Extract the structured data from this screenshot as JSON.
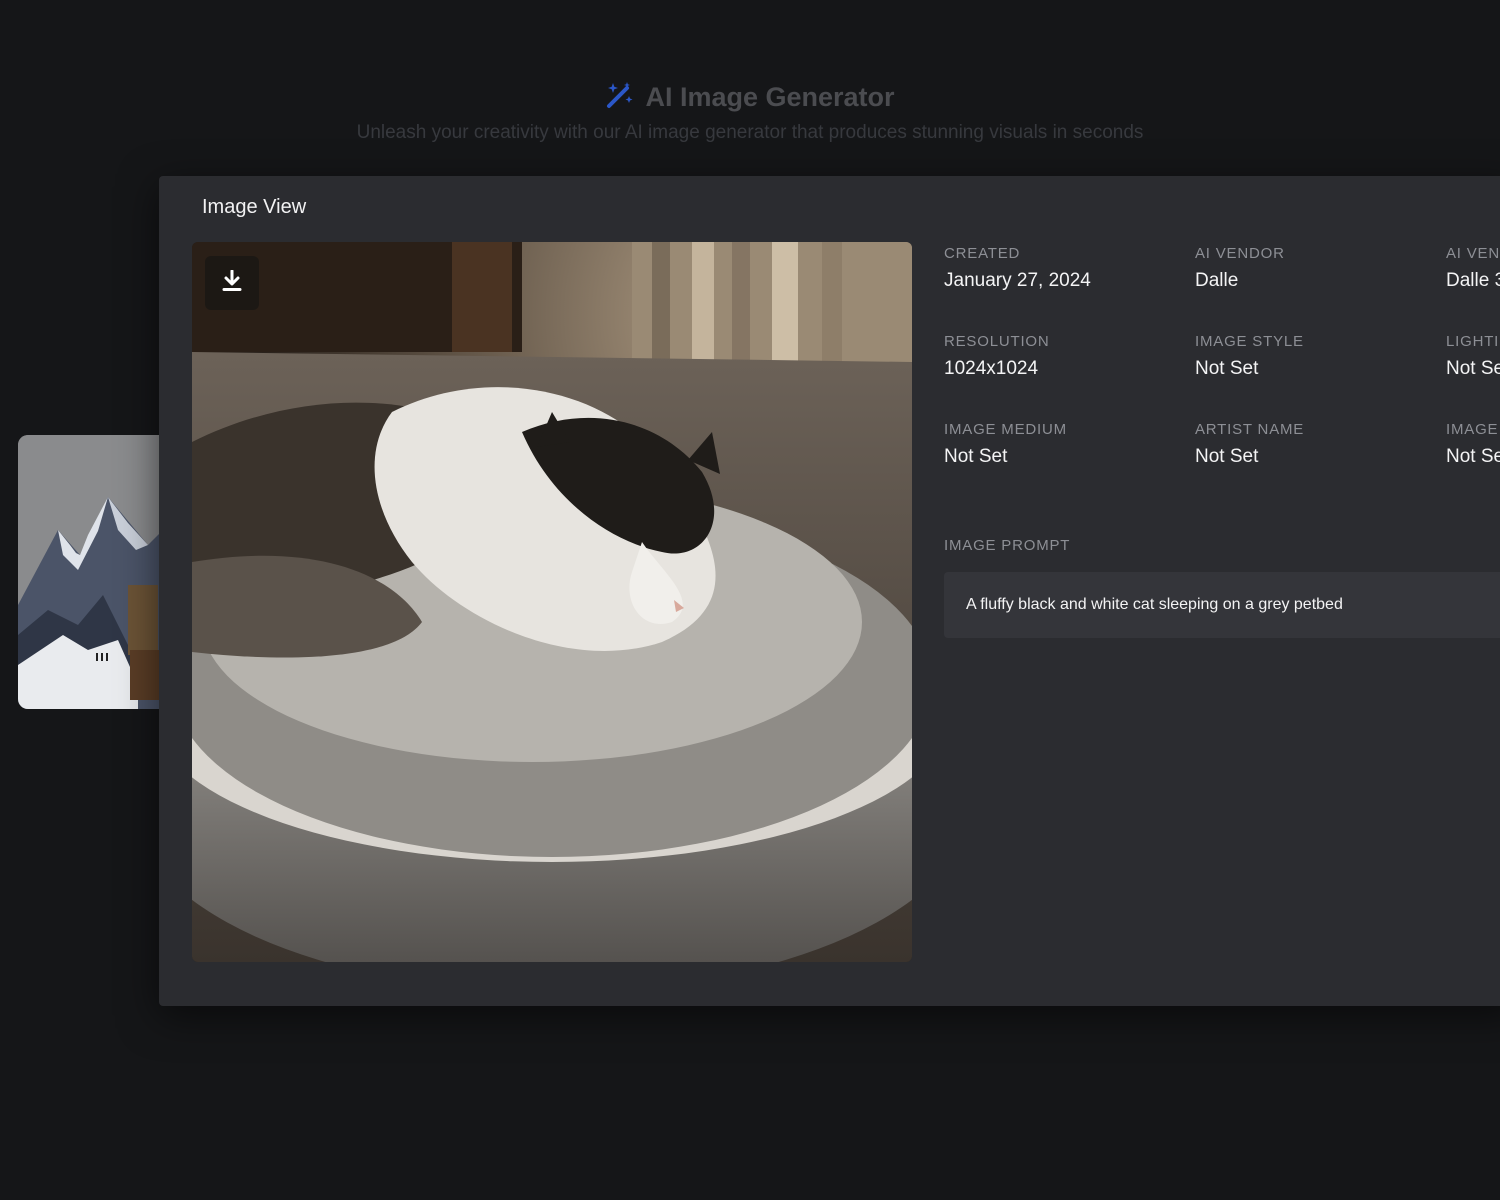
{
  "header": {
    "icon": "magic-wand-icon",
    "title": "AI Image Generator",
    "subtitle": "Unleash your creativity with our AI image generator that produces stunning visuals in seconds",
    "accent_color": "#2b57c8"
  },
  "modal": {
    "title": "Image View",
    "download_icon": "download-icon",
    "fields": [
      {
        "label": "CREATED",
        "value": "January 27, 2024"
      },
      {
        "label": "AI VENDOR",
        "value": "Dalle"
      },
      {
        "label": "AI VEN",
        "value": "Dalle 3"
      },
      {
        "label": "RESOLUTION",
        "value": "1024x1024"
      },
      {
        "label": "IMAGE STYLE",
        "value": "Not Set"
      },
      {
        "label": "LIGHTI",
        "value": "Not Se"
      },
      {
        "label": "IMAGE MEDIUM",
        "value": "Not Set"
      },
      {
        "label": "ARTIST NAME",
        "value": "Not Set"
      },
      {
        "label": "IMAGE",
        "value": "Not Se"
      }
    ],
    "prompt_label": "IMAGE PROMPT",
    "prompt_text": "A fluffy black and white cat sleeping on a grey petbed"
  }
}
